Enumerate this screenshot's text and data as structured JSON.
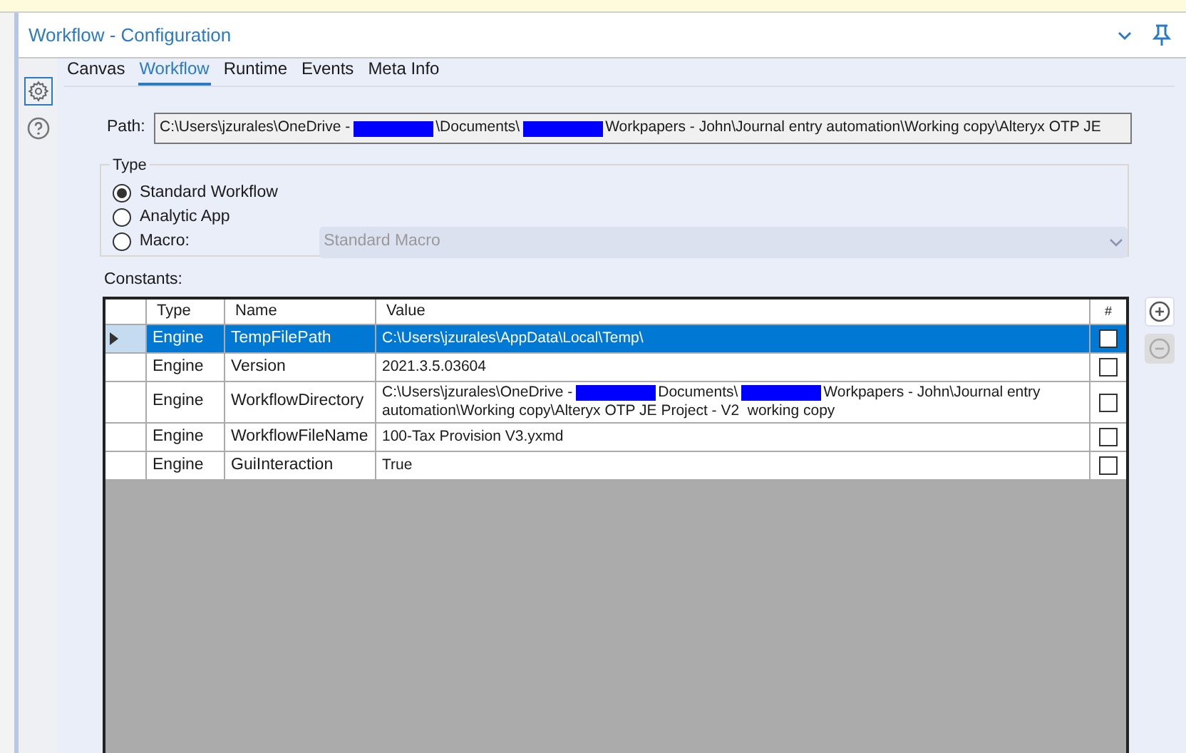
{
  "window": {
    "title": "Workflow - Configuration"
  },
  "tabs": [
    {
      "label": "Canvas",
      "selected": false
    },
    {
      "label": "Workflow",
      "selected": true
    },
    {
      "label": "Runtime",
      "selected": false
    },
    {
      "label": "Events",
      "selected": false
    },
    {
      "label": "Meta Info",
      "selected": false
    }
  ],
  "path": {
    "label": "Path:",
    "value": [
      {
        "kind": "text",
        "text": "C:\\Users\\jzurales\\OneDrive -"
      },
      {
        "kind": "redacted"
      },
      {
        "kind": "text",
        "text": "\\Documents\\"
      },
      {
        "kind": "redacted"
      },
      {
        "kind": "text",
        "text": "Workpapers - John\\Journal entry automation\\Working copy\\Alteryx OTP JE"
      }
    ]
  },
  "type_group": {
    "label": "Type",
    "options": [
      {
        "label": "Standard Workflow",
        "selected": true
      },
      {
        "label": "Analytic App",
        "selected": false
      },
      {
        "label": "Macro:",
        "selected": false
      }
    ],
    "macro_select": {
      "value": "Standard Macro",
      "disabled": true
    }
  },
  "constants": {
    "label": "Constants:",
    "columns": [
      "Type",
      "Name",
      "Value",
      "#"
    ],
    "rows": [
      {
        "type": "Engine",
        "name": "TempFilePath",
        "value": [
          {
            "kind": "text",
            "text": "C:\\Users\\jzurales\\AppData\\Local\\Temp\\"
          }
        ],
        "checked": false,
        "selected": true
      },
      {
        "type": "Engine",
        "name": "Version",
        "value": [
          {
            "kind": "text",
            "text": "2021.3.5.03604"
          }
        ],
        "checked": false,
        "selected": false
      },
      {
        "type": "Engine",
        "name": "WorkflowDirectory",
        "value": [
          {
            "kind": "text",
            "text": "C:\\Users\\jzurales\\OneDrive -"
          },
          {
            "kind": "redacted"
          },
          {
            "kind": "text",
            "text": "Documents\\"
          },
          {
            "kind": "redacted"
          },
          {
            "kind": "text",
            "text": "Workpapers - John\\Journal entry"
          },
          {
            "kind": "break"
          },
          {
            "kind": "text",
            "text": "automation\\Working copy\\Alteryx OTP JE Project - V2  working copy"
          }
        ],
        "checked": false,
        "selected": false
      },
      {
        "type": "Engine",
        "name": "WorkflowFileName",
        "value": [
          {
            "kind": "text",
            "text": "100-Tax Provision V3.yxmd"
          }
        ],
        "checked": false,
        "selected": false
      },
      {
        "type": "Engine",
        "name": "GuiInteraction",
        "value": [
          {
            "kind": "text",
            "text": "True"
          }
        ],
        "checked": false,
        "selected": false
      }
    ],
    "add_disabled": false,
    "remove_disabled": true
  }
}
